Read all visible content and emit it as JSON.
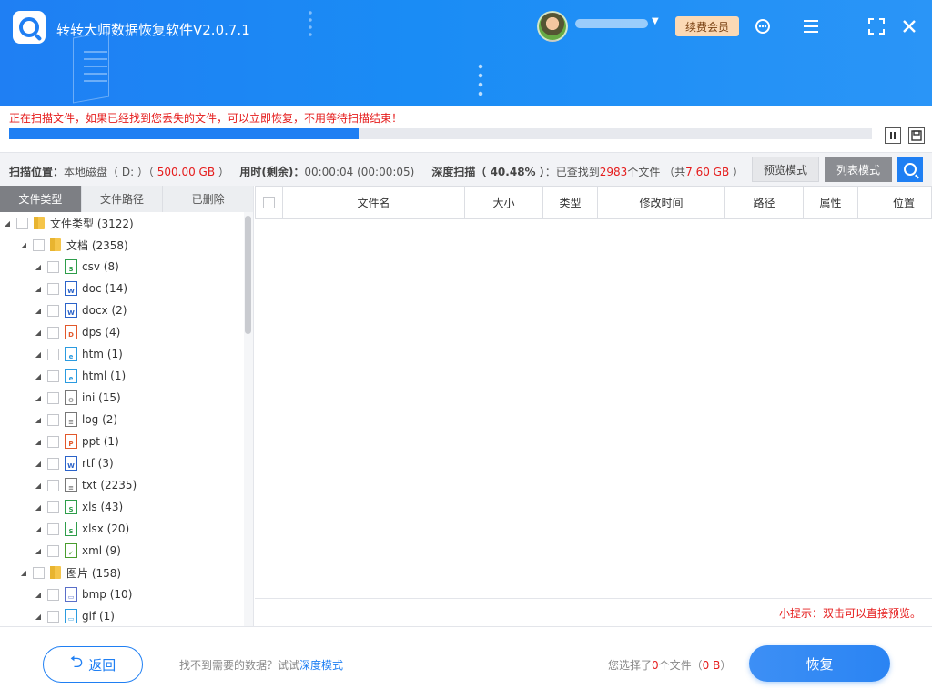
{
  "app": {
    "title": "转转大师数据恢复软件V2.0.7.1",
    "vip_label": "续费会员",
    "colors": {
      "primary": "#1f7ff3",
      "alert": "#e51c1c",
      "vip_bg": "#fbd9b5"
    }
  },
  "header_icons": [
    "support-icon",
    "menu-icon",
    "maximize-icon",
    "close-icon"
  ],
  "scan": {
    "message": "正在扫描文件，如果已经找到您丢失的文件，可以立即恢复，不用等待扫描结束！",
    "progress": 0.4048
  },
  "info": {
    "location_label": "扫描位置：",
    "location_value": "本地磁盘（ D: ）（ ",
    "capacity": "500.00 GB",
    "capacity_close": " ）",
    "time_label": "用时(剩余)：",
    "time_value": "00:00:04 (00:00:05)",
    "scan_label": "深度扫描（ 40.48% ）",
    "found_prefix": "：已查找到",
    "found_count": "2983",
    "found_suffix": "个文件 （共",
    "found_size": "7.60 GB",
    "found_close": " ）",
    "preview_mode": "预览模式",
    "list_mode": "列表模式"
  },
  "tabs": [
    "文件类型",
    "文件路径",
    "已删除"
  ],
  "tree": {
    "root": "文件类型 (3122)",
    "documents": "文档 (2358)",
    "doc_items": [
      {
        "label": "csv (8)",
        "icon": "S",
        "color": "#2e9d4a"
      },
      {
        "label": "doc (14)",
        "icon": "W",
        "color": "#2b63c9"
      },
      {
        "label": "docx (2)",
        "icon": "W",
        "color": "#2b63c9"
      },
      {
        "label": "dps (4)",
        "icon": "D",
        "color": "#e2582b"
      },
      {
        "label": "htm (1)",
        "icon": "e",
        "color": "#2b9be0"
      },
      {
        "label": "html (1)",
        "icon": "e",
        "color": "#2b9be0"
      },
      {
        "label": "ini (15)",
        "icon": "⚙",
        "color": "#777"
      },
      {
        "label": "log (2)",
        "icon": "≡",
        "color": "#777"
      },
      {
        "label": "ppt (1)",
        "icon": "P",
        "color": "#e2582b"
      },
      {
        "label": "rtf (3)",
        "icon": "W",
        "color": "#2b63c9"
      },
      {
        "label": "txt (2235)",
        "icon": "≡",
        "color": "#777"
      },
      {
        "label": "xls (43)",
        "icon": "S",
        "color": "#2e9d4a"
      },
      {
        "label": "xlsx (20)",
        "icon": "S",
        "color": "#2e9d4a"
      },
      {
        "label": "xml (9)",
        "icon": "✓",
        "color": "#4a9d2e"
      }
    ],
    "images": "图片 (158)",
    "image_items": [
      {
        "label": "bmp (10)",
        "icon": "▭",
        "color": "#5a6fc9"
      },
      {
        "label": "gif (1)",
        "icon": "▭",
        "color": "#2b9be0"
      }
    ]
  },
  "table": {
    "columns": [
      "文件名",
      "大小",
      "类型",
      "修改时间",
      "路径",
      "属性",
      "位置"
    ],
    "tip": "小提示：双击可以直接预览。"
  },
  "footer": {
    "back": "返回",
    "hint_prefix": "找不到需要的数据？试试",
    "hint_link": "深度模式",
    "selected_prefix": "您选择了",
    "selected_count": "0",
    "selected_mid": "个文件（",
    "selected_size": "0 B",
    "selected_close": "）",
    "recover": "恢复"
  }
}
